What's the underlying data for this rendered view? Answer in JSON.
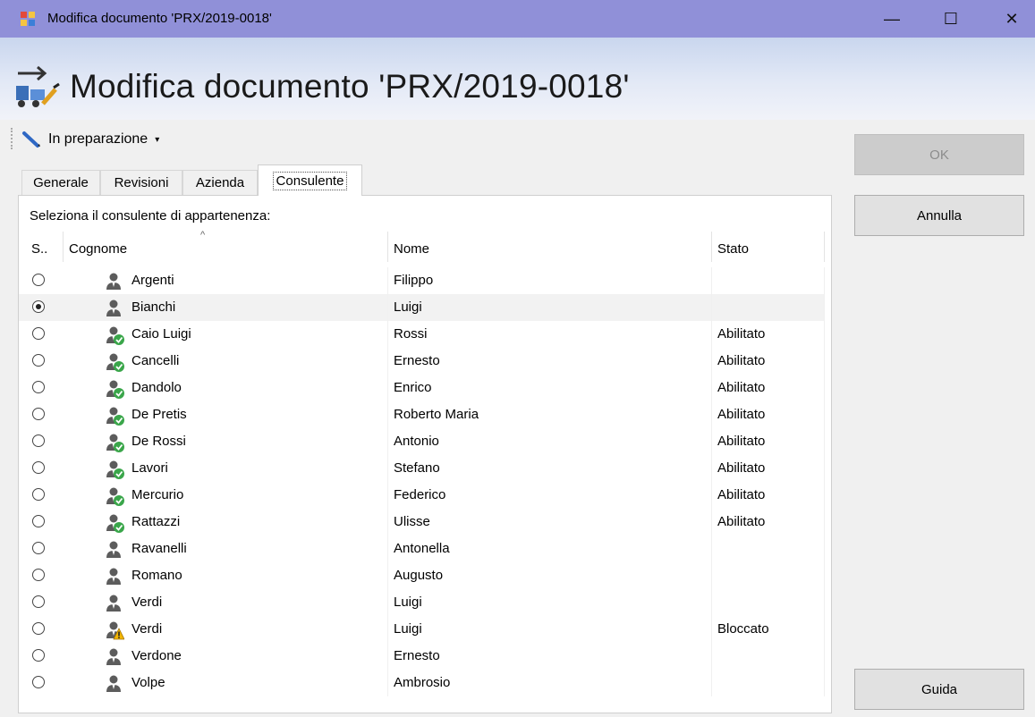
{
  "window": {
    "title": "Modifica documento 'PRX/2019-0018'",
    "minimize_glyph": "—",
    "maximize_glyph": "☐",
    "close_glyph": "✕"
  },
  "header": {
    "title": "Modifica documento 'PRX/2019-0018'"
  },
  "toolbar": {
    "status_label": "In preparazione",
    "status_caret": "▾"
  },
  "tabs": [
    {
      "label": "Generale"
    },
    {
      "label": "Revisioni"
    },
    {
      "label": "Azienda"
    },
    {
      "label": "Consulente"
    }
  ],
  "active_tab": "Consulente",
  "consulente": {
    "instruction": "Seleziona il consulente di appartenenza:",
    "sort_indicator": "^",
    "columns": {
      "s": "S..",
      "cognome": "Cognome",
      "nome": "Nome",
      "stato": "Stato"
    },
    "rows": [
      {
        "cognome": "Argenti",
        "nome": "Filippo",
        "stato": "",
        "icon": "person-icon",
        "selected": false
      },
      {
        "cognome": "Bianchi",
        "nome": "Luigi",
        "stato": "",
        "icon": "person-icon",
        "selected": true
      },
      {
        "cognome": "Caio Luigi",
        "nome": "Rossi",
        "stato": "Abilitato",
        "icon": "person-check-icon",
        "selected": false
      },
      {
        "cognome": "Cancelli",
        "nome": "Ernesto",
        "stato": "Abilitato",
        "icon": "person-check-icon",
        "selected": false
      },
      {
        "cognome": "Dandolo",
        "nome": "Enrico",
        "stato": "Abilitato",
        "icon": "person-check-icon",
        "selected": false
      },
      {
        "cognome": "De Pretis",
        "nome": "Roberto Maria",
        "stato": "Abilitato",
        "icon": "person-check-icon",
        "selected": false
      },
      {
        "cognome": "De Rossi",
        "nome": "Antonio",
        "stato": "Abilitato",
        "icon": "person-check-icon",
        "selected": false
      },
      {
        "cognome": "Lavori",
        "nome": "Stefano",
        "stato": "Abilitato",
        "icon": "person-check-icon",
        "selected": false
      },
      {
        "cognome": "Mercurio",
        "nome": "Federico",
        "stato": "Abilitato",
        "icon": "person-check-icon",
        "selected": false
      },
      {
        "cognome": "Rattazzi",
        "nome": "Ulisse",
        "stato": "Abilitato",
        "icon": "person-check-icon",
        "selected": false
      },
      {
        "cognome": "Ravanelli",
        "nome": "Antonella",
        "stato": "",
        "icon": "person-icon",
        "selected": false
      },
      {
        "cognome": "Romano",
        "nome": "Augusto",
        "stato": "",
        "icon": "person-icon",
        "selected": false
      },
      {
        "cognome": "Verdi",
        "nome": "Luigi",
        "stato": "",
        "icon": "person-icon",
        "selected": false
      },
      {
        "cognome": "Verdi",
        "nome": "Luigi",
        "stato": "Bloccato",
        "icon": "person-warning-icon",
        "selected": false
      },
      {
        "cognome": "Verdone",
        "nome": "Ernesto",
        "stato": "",
        "icon": "person-icon",
        "selected": false
      },
      {
        "cognome": "Volpe",
        "nome": "Ambrosio",
        "stato": "",
        "icon": "person-icon",
        "selected": false
      }
    ]
  },
  "buttons": {
    "ok": "OK",
    "annulla": "Annulla",
    "guida": "Guida"
  },
  "colors": {
    "titlebar": "#9090d8",
    "header_gradient_top": "#c9d6ee",
    "selected_row": "#f2f2f2",
    "check_green": "#3aa64a",
    "warning_yellow": "#f2b600"
  }
}
